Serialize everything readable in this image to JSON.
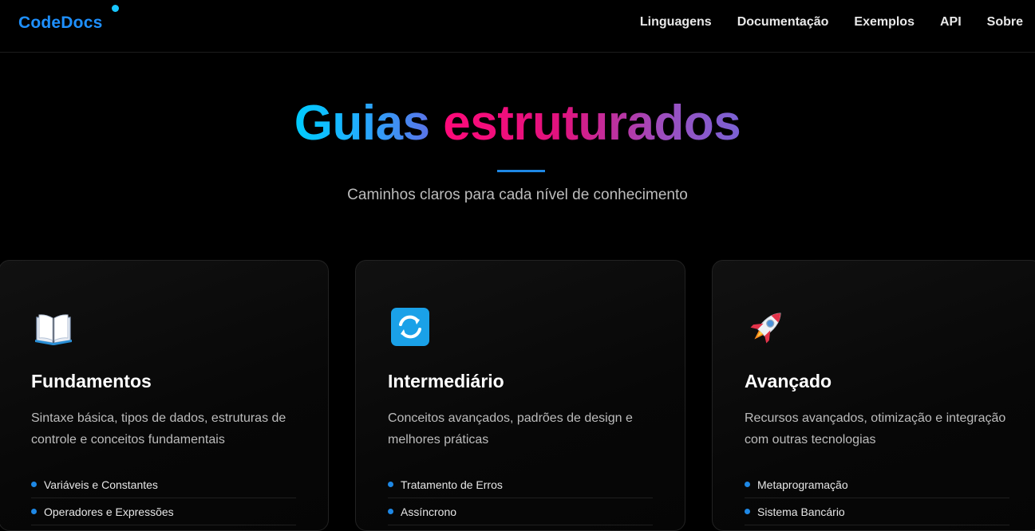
{
  "header": {
    "logo": "CodeDocs",
    "nav": [
      "Linguagens",
      "Documentação",
      "Exemplos",
      "API",
      "Sobre"
    ]
  },
  "hero": {
    "title_word1": "Guias",
    "title_word2": "estruturados",
    "subtitle": "Caminhos claros para cada nível de conhecimento"
  },
  "cards": [
    {
      "icon": "open-book-icon",
      "title": "Fundamentos",
      "description": "Sintaxe básica, tipos de dados, estruturas de controle e conceitos fundamentais",
      "items": [
        "Variáveis e Constantes",
        "Operadores e Expressões"
      ]
    },
    {
      "icon": "refresh-icon",
      "title": "Intermediário",
      "description": "Conceitos avançados, padrões de design e melhores práticas",
      "items": [
        "Tratamento de Erros",
        "Assíncrono"
      ]
    },
    {
      "icon": "rocket-icon",
      "title": "Avançado",
      "description": "Recursos avançados, otimização e integração com outras tecnologias",
      "items": [
        "Metaprogramação",
        "Sistema Bancário"
      ]
    }
  ],
  "colors": {
    "accent": "#1e88e5",
    "logo": "#1e90ff",
    "background": "#000000"
  }
}
